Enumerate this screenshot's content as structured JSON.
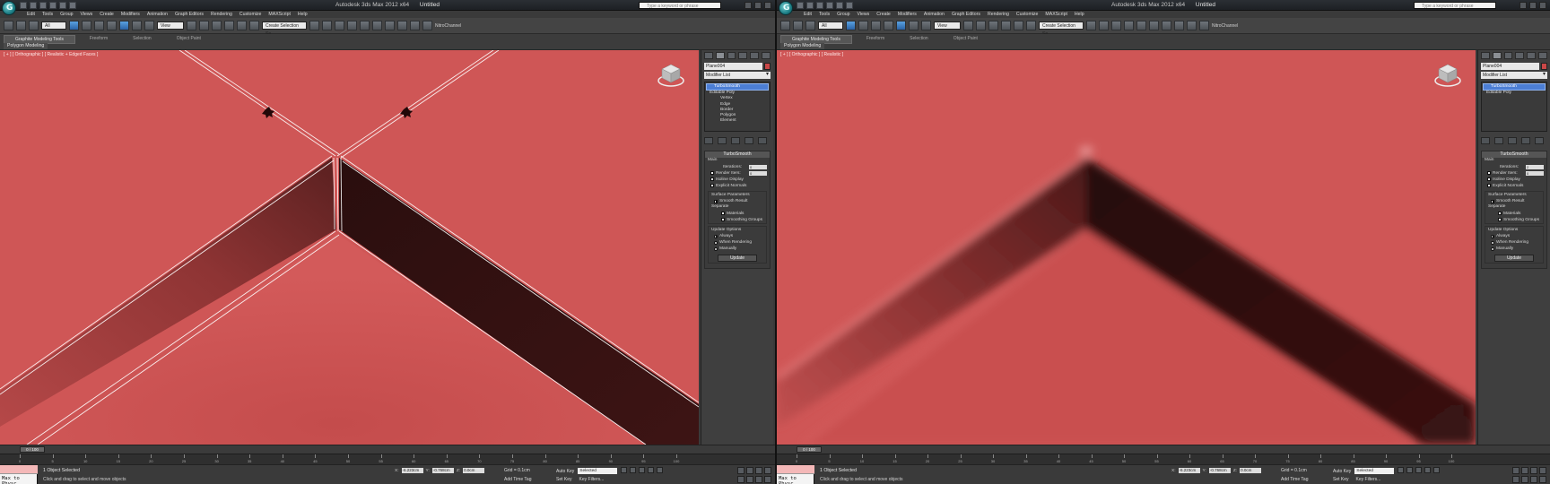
{
  "screens": [
    {
      "window_title": "Autodesk 3ds Max 2012 x64",
      "doc_title": "Untitled",
      "search_placeholder": "Type a keyword or phrase",
      "menus": [
        "Edit",
        "Tools",
        "Group",
        "Views",
        "Create",
        "Modifiers",
        "Animation",
        "Graph Editors",
        "Rendering",
        "Customize",
        "MAXScript",
        "Help"
      ],
      "toolbar": {
        "filter": "All",
        "ref_coord": "View",
        "named_sel": "Create Selection Se",
        "channel": "NitroChannel"
      },
      "ribbon": {
        "tabs": [
          "Graphite Modeling Tools",
          "Freeform",
          "Selection",
          "Object Paint"
        ],
        "sub": "Polygon Modeling"
      },
      "viewport_label": "[ + ] [ Orthographic ] [ Realistic + Edged Faces ]",
      "command_panel": {
        "object_name": "Plane004",
        "modifier_list": "Modifier List",
        "stack": [
          {
            "label": "TurboSmooth",
            "kind": "selected"
          },
          {
            "label": "Editable Poly",
            "kind": "plain"
          },
          {
            "label": "Vertex",
            "kind": "sub"
          },
          {
            "label": "Edge",
            "kind": "sub"
          },
          {
            "label": "Border",
            "kind": "sub"
          },
          {
            "label": "Polygon",
            "kind": "sub"
          },
          {
            "label": "Element",
            "kind": "sub"
          }
        ],
        "rollout_title": "TurboSmooth",
        "main_label": "Main",
        "iterations_label": "Iterations:",
        "iterations_value": "0",
        "render_iters_label": "Render Iters:",
        "render_iters_value": "0",
        "isoline_label": "Isoline Display",
        "explicit_label": "Explicit Normals",
        "surface_label": "Surface Parameters",
        "smooth_result_label": "Smooth Result",
        "separate_label": "Separate",
        "materials_label": "Materials",
        "smoothing_label": "Smoothing Groups",
        "update_options_label": "Update Options",
        "always_label": "Always",
        "when_rendering_label": "When Rendering",
        "manually_label": "Manually",
        "update_button": "Update"
      },
      "time_slider": "0 / 100",
      "track_ticks": [
        "0",
        "5",
        "10",
        "15",
        "20",
        "25",
        "30",
        "35",
        "40",
        "45",
        "50",
        "55",
        "60",
        "65",
        "70",
        "75",
        "80",
        "85",
        "90",
        "95",
        "100"
      ],
      "maxscript": "Max to Physc",
      "status_line": "1 Object Selected",
      "prompt_line": "Click and drag to select and move objects",
      "coords": {
        "x": "-6.223cm",
        "y": "-0.768cm",
        "z": "0.0cm"
      },
      "grid": "Grid = 0.1cm",
      "add_time_tag": "Add Time Tag",
      "auto_key": "Auto Key",
      "auto_key_sel": "Selected",
      "set_key": "Set Key",
      "key_filters": "Key Filters..."
    },
    {
      "window_title": "Autodesk 3ds Max 2012 x64",
      "doc_title": "Untitled",
      "search_placeholder": "Type a keyword or phrase",
      "menus": [
        "Edit",
        "Tools",
        "Group",
        "Views",
        "Create",
        "Modifiers",
        "Animation",
        "Graph Editors",
        "Rendering",
        "Customize",
        "MAXScript",
        "Help"
      ],
      "toolbar": {
        "filter": "All",
        "ref_coord": "View",
        "named_sel": "Create Selection Se",
        "channel": "NitroChannel"
      },
      "ribbon": {
        "tabs": [
          "Graphite Modeling Tools",
          "Freeform",
          "Selection",
          "Object Paint"
        ],
        "sub": "Polygon Modeling"
      },
      "viewport_label": "[ + ] [ Orthographic ] [ Realistic ]",
      "command_panel": {
        "object_name": "Plane004",
        "modifier_list": "Modifier List",
        "stack": [
          {
            "label": "TurboSmooth",
            "kind": "selected"
          },
          {
            "label": "Editable Poly",
            "kind": "plain"
          }
        ],
        "rollout_title": "TurboSmooth",
        "main_label": "Main",
        "iterations_label": "Iterations:",
        "iterations_value": "2",
        "render_iters_label": "Render Iters:",
        "render_iters_value": "0",
        "isoline_label": "Isoline Display",
        "explicit_label": "Explicit Normals",
        "surface_label": "Surface Parameters",
        "smooth_result_label": "Smooth Result",
        "separate_label": "Separate",
        "materials_label": "Materials",
        "smoothing_label": "Smoothing Groups",
        "update_options_label": "Update Options",
        "always_label": "Always",
        "when_rendering_label": "When Rendering",
        "manually_label": "Manually",
        "update_button": "Update"
      },
      "time_slider": "0 / 100",
      "track_ticks": [
        "0",
        "5",
        "10",
        "15",
        "20",
        "25",
        "30",
        "35",
        "40",
        "45",
        "50",
        "55",
        "60",
        "65",
        "70",
        "75",
        "80",
        "85",
        "90",
        "95",
        "100"
      ],
      "maxscript": "Max to Physc",
      "status_line": "1 Object Selected",
      "prompt_line": "Click and drag to select and move objects",
      "coords": {
        "x": "-6.223cm",
        "y": "-0.768cm",
        "z": "0.0cm"
      },
      "grid": "Grid = 0.1cm",
      "add_time_tag": "Add Time Tag",
      "auto_key": "Auto Key",
      "auto_key_sel": "Selected",
      "set_key": "Set Key",
      "key_filters": "Key Filters..."
    }
  ],
  "colors": {
    "viewport_bg": "#cf5555",
    "selected_stack": "#4c7ed4",
    "dark_face": "#3a1414"
  }
}
